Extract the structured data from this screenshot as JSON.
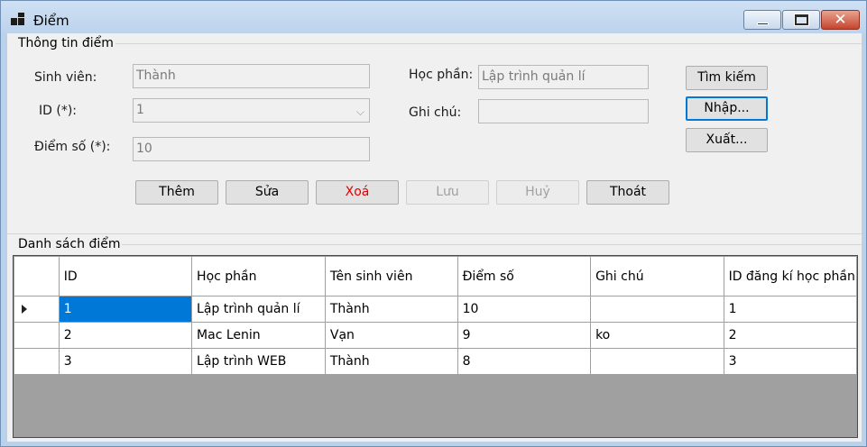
{
  "window": {
    "title": "Điểm",
    "close_glyph": "✕",
    "app_icon": "app-icon"
  },
  "group_info": {
    "title": "Thông tin điểm",
    "student_label": "Sinh viên:",
    "student_value": "Thành",
    "id_label": "ID (*):",
    "id_value": "1",
    "combo_arrow": "⌵",
    "score_label": "Điểm số (*):",
    "score_value": "10",
    "course_label": "Học phần:",
    "course_value": "Lập trình quản lí",
    "note_label": "Ghi chú:",
    "note_value": ""
  },
  "side_buttons": {
    "search": "Tìm kiếm",
    "import": "Nhập...",
    "export": "Xuất..."
  },
  "actions": {
    "add": "Thêm",
    "edit": "Sửa",
    "delete": "Xoá",
    "save": "Lưu",
    "cancel": "Huỷ",
    "exit": "Thoát"
  },
  "group_list": {
    "title": "Danh sách điểm"
  },
  "grid": {
    "columns": [
      "ID",
      "Học phần",
      "Tên sinh viên",
      "Điểm số",
      "Ghi chú",
      "ID đăng kí học phần"
    ],
    "rows": [
      [
        "1",
        "Lập trình quản lí",
        "Thành",
        "10",
        "",
        "1"
      ],
      [
        "2",
        "Mac Lenin",
        "Vạn",
        "9",
        "ko",
        "2"
      ],
      [
        "3",
        "Lập trình WEB",
        "Thành",
        "8",
        "",
        "3"
      ]
    ]
  },
  "colors": {
    "selection": "#0078d7",
    "delete_text": "#e00000",
    "grid_background": "#a0a0a0"
  }
}
